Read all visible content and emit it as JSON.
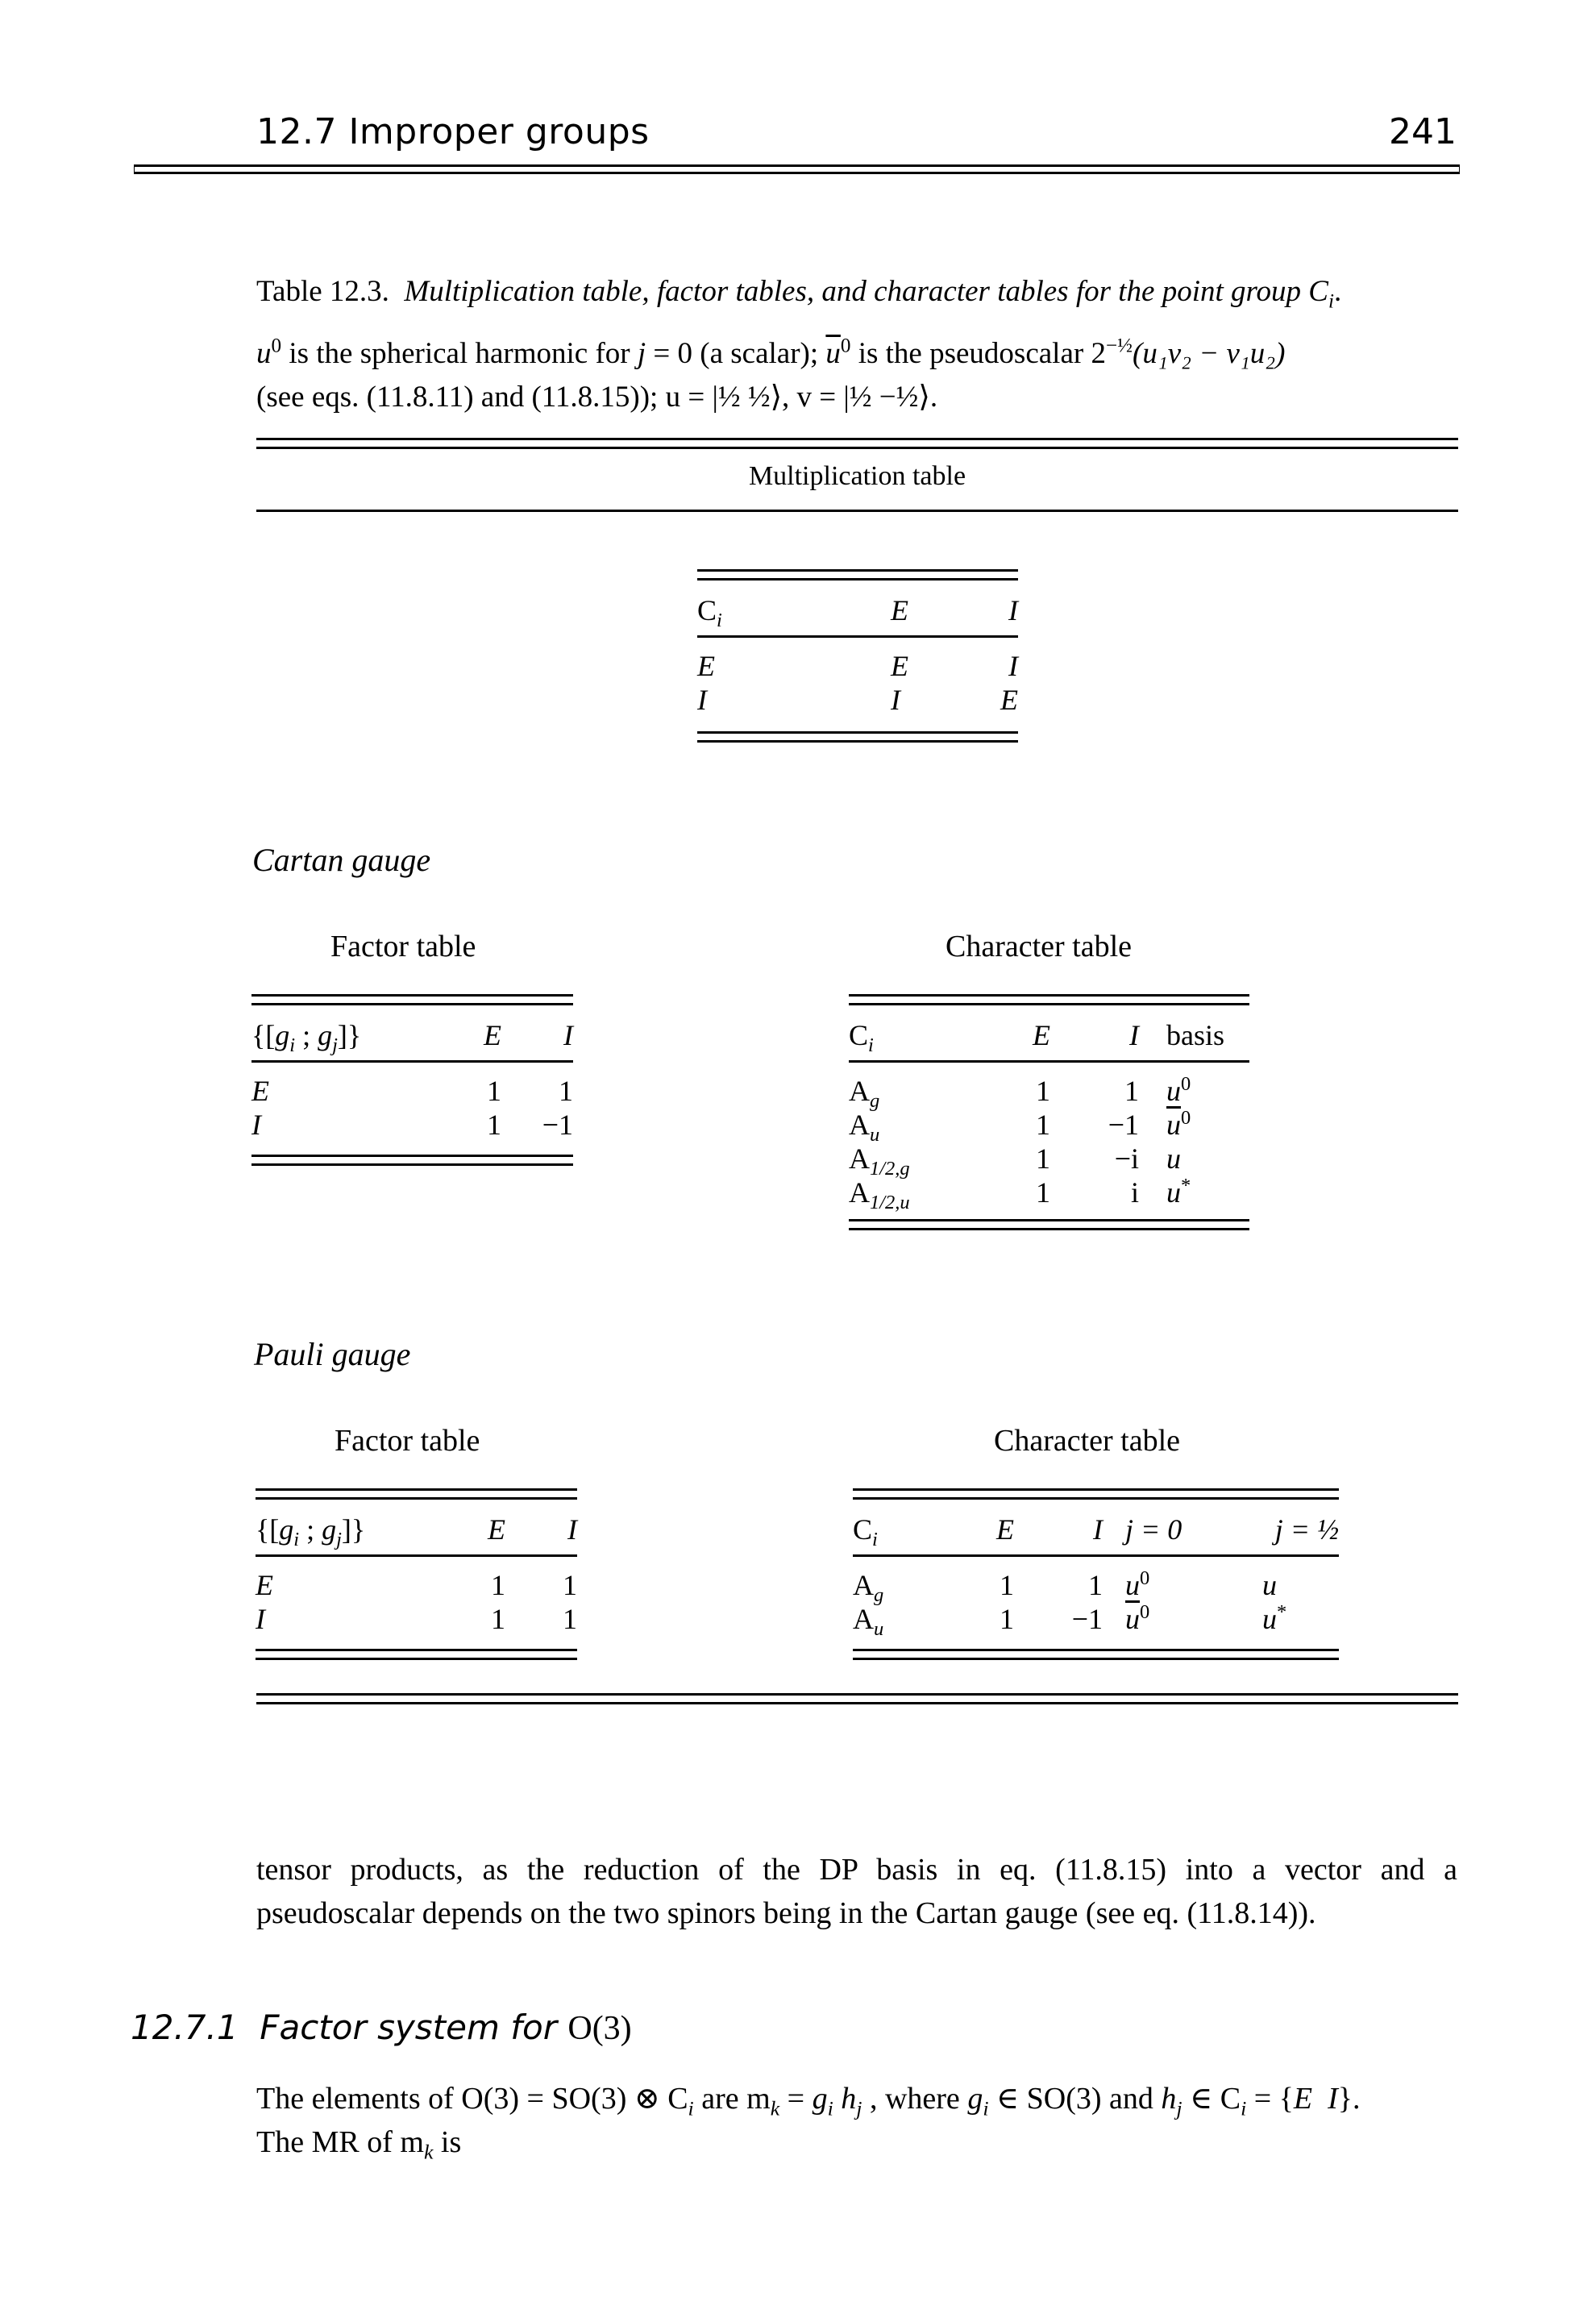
{
  "running_header": {
    "section": "12.7  Improper groups",
    "page_number": "241"
  },
  "caption": {
    "label": "Table 12.3.",
    "title": "Multiplication table, factor tables, and character tables for the point group C",
    "title_sub": "i",
    "title_end": ".",
    "line2": {
      "u0_base": "u",
      "u0_sup": "0",
      "text1": " is the spherical harmonic for ",
      "j": "j",
      "text2": " = 0 (a scalar); ",
      "ubar_base": "u",
      "ubar_sup": "0",
      "text3": " is the pseudoscalar 2",
      "exp": "−½",
      "formula": "(u₁v₂ − v₁u₂)"
    },
    "line3": "(see eqs. (11.8.11) and (11.8.15)); u = |½ ½⟩, v = |½ −½⟩."
  },
  "multiplication_table": {
    "heading": "Multiplication table",
    "corner": "C",
    "corner_sub": "i",
    "columns": [
      "E",
      "I"
    ],
    "rows": [
      {
        "label": "E",
        "cells": [
          "E",
          "I"
        ]
      },
      {
        "label": "I",
        "cells": [
          "I",
          "E"
        ]
      }
    ]
  },
  "cartan_gauge": {
    "label": "Cartan gauge",
    "factor_table": {
      "title": "Factor table",
      "corner": "{[g_i ; g_j]}",
      "columns": [
        "E",
        "I"
      ],
      "rows": [
        {
          "label": "E",
          "cells": [
            "1",
            "1"
          ]
        },
        {
          "label": "I",
          "cells": [
            "1",
            "−1"
          ]
        }
      ]
    },
    "character_table": {
      "title": "Character table",
      "corner": "C",
      "corner_sub": "i",
      "columns": [
        "E",
        "I",
        "basis"
      ],
      "rows": [
        {
          "label": "A",
          "label_sub": "g",
          "cells": [
            "1",
            "1"
          ],
          "basis": "u",
          "basis_sup": "0",
          "basis_bar": false
        },
        {
          "label": "A",
          "label_sub": "u",
          "cells": [
            "1",
            "−1"
          ],
          "basis": "u",
          "basis_sup": "0",
          "basis_bar": true
        },
        {
          "label": "A",
          "label_sub": "1/2,g",
          "cells": [
            "1",
            "−i"
          ],
          "basis": "u",
          "basis_sup": "",
          "basis_bar": false
        },
        {
          "label": "A",
          "label_sub": "1/2,u",
          "cells": [
            "1",
            "i"
          ],
          "basis": "u",
          "basis_sup": "*",
          "basis_bar": false
        }
      ]
    }
  },
  "pauli_gauge": {
    "label": "Pauli gauge",
    "factor_table": {
      "title": "Factor table",
      "corner": "{[g_i ; g_j]}",
      "columns": [
        "E",
        "I"
      ],
      "rows": [
        {
          "label": "E",
          "cells": [
            "1",
            "1"
          ]
        },
        {
          "label": "I",
          "cells": [
            "1",
            "1"
          ]
        }
      ]
    },
    "character_table": {
      "title": "Character table",
      "corner": "C",
      "corner_sub": "i",
      "columns": [
        "E",
        "I",
        "j = 0",
        "j = ½"
      ],
      "rows": [
        {
          "label": "A",
          "label_sub": "g",
          "cells": [
            "1",
            "1"
          ],
          "j0": "u",
          "j0_sup": "0",
          "j0_bar": false,
          "jhalf": "u",
          "jhalf_sup": ""
        },
        {
          "label": "A",
          "label_sub": "u",
          "cells": [
            "1",
            "−1"
          ],
          "j0": "u",
          "j0_sup": "0",
          "j0_bar": true,
          "jhalf": "u",
          "jhalf_sup": "*"
        }
      ]
    }
  },
  "body": {
    "paragraph1_line1": "tensor products, as the reduction of the DP basis in eq. (11.8.15) into a vector and a",
    "paragraph1_line2": "pseudoscalar depends on the two spinors being in the Cartan gauge (see eq. (11.8.14)).",
    "subsection_number": "12.7.1",
    "subsection_title": "Factor system for ",
    "subsection_title_upright": "O(3)",
    "paragraph2_line1": "The elements of O(3) = SO(3) ⊗ C",
    "paragraph2_line1_rest": " are m",
    "paragraph2_line2": "The MR of m"
  }
}
